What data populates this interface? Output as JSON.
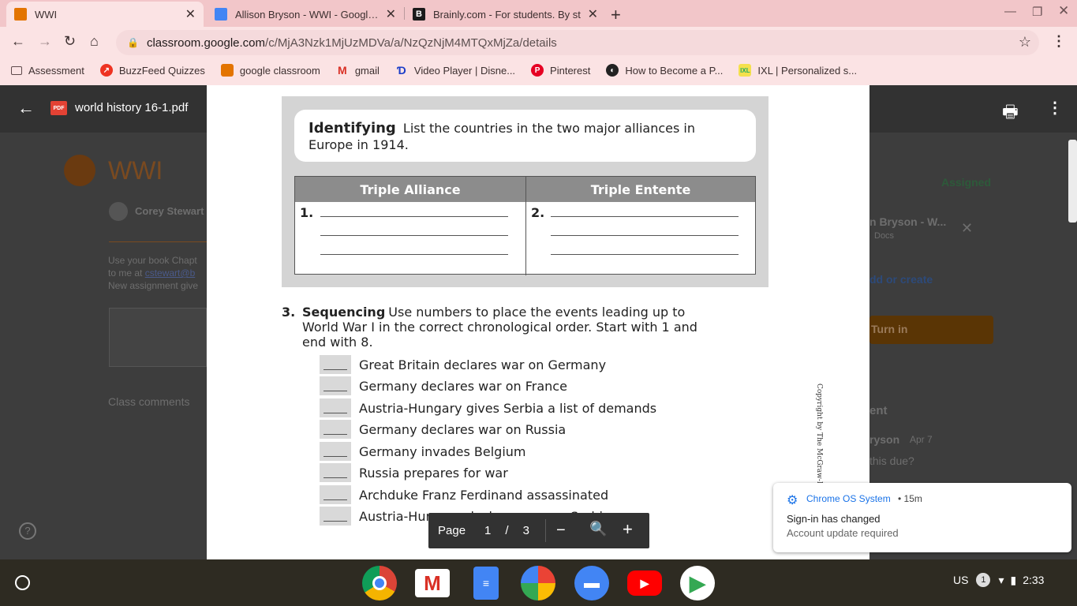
{
  "browser": {
    "tabs": [
      {
        "title": "WWI",
        "icon": "classroom-icon",
        "active": true
      },
      {
        "title": "Allison Bryson - WWI - Google Do",
        "icon": "docs-icon"
      },
      {
        "title": "Brainly.com - For students. By st",
        "icon": "brainly-icon"
      }
    ],
    "url_host": "classroom.google.com",
    "url_path": "/c/MjA3Nzk1MjUzMDVa/a/NzQzNjM4MTQxMjZa/details",
    "bookmarks": [
      {
        "label": "Assessment",
        "icon": "folder-icon"
      },
      {
        "label": "BuzzFeed Quizzes",
        "icon": "buzzfeed-icon"
      },
      {
        "label": "google classroom",
        "icon": "classroom-icon"
      },
      {
        "label": "gmail",
        "icon": "gmail-icon"
      },
      {
        "label": "Video Player | Disne...",
        "icon": "disney-icon"
      },
      {
        "label": "Pinterest",
        "icon": "pinterest-icon"
      },
      {
        "label": "How to Become a P...",
        "icon": "globe-icon"
      },
      {
        "label": "IXL | Personalized s...",
        "icon": "ixl-icon"
      }
    ]
  },
  "viewer": {
    "file_name": "world history 16-1.pdf",
    "pdf_badge": "PDF",
    "page_label": "Page",
    "page_current": "1",
    "page_sep": "/",
    "page_total": "3"
  },
  "background": {
    "class_title": "WWI",
    "teacher": "Corey Stewart",
    "desc1": "Use your book Chapt",
    "desc2": "to me at",
    "desc_link": "cstewart@b",
    "desc3": "New assignment give",
    "class_comments": "Class comments",
    "assigned": "Assigned",
    "attachment": "n Bryson - W...",
    "attachment_type": "Docs",
    "add_create": "dd or create",
    "turn_in": "Turn in",
    "private_comment": "ent",
    "commenter": "ryson",
    "comment_date": "Apr 7",
    "comment_text": "this due?"
  },
  "pdf": {
    "identifying_label": "Identifying",
    "identifying_text": "List the countries in the two major alliances in Europe in 1914.",
    "col1_header": "Triple Alliance",
    "col2_header": "Triple Entente",
    "col1_num": "1.",
    "col2_num": "2.",
    "seq_num": "3.",
    "seq_label": "Sequencing",
    "seq_text": "Use numbers to place the events leading up to World War I in the correct chronological order. Start with 1 and end with 8.",
    "events": [
      "Great Britain declares war on Germany",
      "Germany declares war on France",
      "Austria-Hungary gives Serbia a list of demands",
      "Germany declares war on Russia",
      "Germany invades Belgium",
      "Russia prepares for war",
      "Archduke Franz Ferdinand assassinated",
      "Austria-Hungary declares war on Serbia"
    ],
    "copyright": "Copyright by The McGraw-Hill"
  },
  "notification": {
    "source": "Chrome OS System",
    "time": "• 15m",
    "title": "Sign-in has changed",
    "body": "Account update required"
  },
  "shelf": {
    "apps": [
      "chrome-icon",
      "gmail-icon",
      "docs-icon",
      "photos-icon",
      "files-icon",
      "youtube-icon",
      "play-store-icon"
    ],
    "ime": "US",
    "notif_count": "1",
    "clock": "2:33"
  },
  "colors": {
    "tab_strip": "#f2c6c9",
    "toolbar": "#fbe3e4",
    "viewer_bar": "#323232",
    "turn_in": "#5a3505"
  }
}
